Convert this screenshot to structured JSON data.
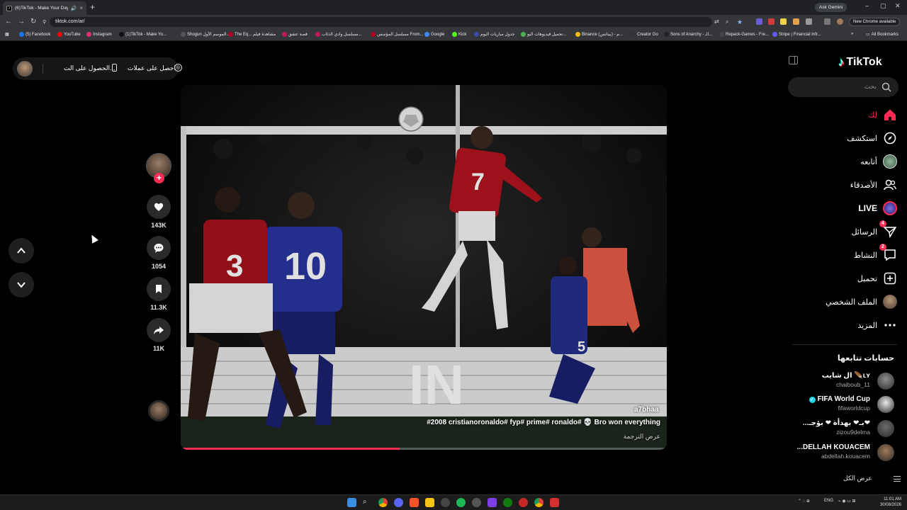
{
  "browser": {
    "tab_title": "(6)TikTok - Make Your Day",
    "url": "tiktok.com/ar/",
    "ask_gemini": "Ask Gemini",
    "new_chrome": "New Chrome available",
    "all_bookmarks": "All Bookmarks",
    "bookmarks": [
      {
        "label": "(5) Facebook",
        "color": "#1877f2"
      },
      {
        "label": "YouTube",
        "color": "#ff0000"
      },
      {
        "label": "Instagram",
        "color": "#e1306c"
      },
      {
        "label": "(1)TikTok - Make Yo...",
        "color": "#111111"
      },
      {
        "label": "Shogun الموسم الأول...",
        "color": "#555555"
      },
      {
        "label": "The Eq... مشاهدة فيلم",
        "color": "#b00020"
      },
      {
        "label": "قصة عشق",
        "color": "#c2185b"
      },
      {
        "label": "مسلسل وادي الذئاب...",
        "color": "#c2185b"
      },
      {
        "label": "مسلسل المؤسس From...",
        "color": "#b00020"
      },
      {
        "label": "Google",
        "color": "#4285f4"
      },
      {
        "label": "Kick",
        "color": "#53fc18"
      },
      {
        "label": "جدول مباريات اليوم",
        "color": "#3949ab"
      },
      {
        "label": "تحميل فيديوهات اليو...",
        "color": "#4caf50"
      },
      {
        "label": "Binance (بينانس) - م...",
        "color": "#f0b90b"
      },
      {
        "label": "Creator Go",
        "color": "#333333"
      },
      {
        "label": "Sons of Anarchy - الـ...",
        "color": "#222222"
      },
      {
        "label": "Repack-Games - Fre...",
        "color": "#444444"
      },
      {
        "label": "Stripe | Financial Infr...",
        "color": "#635bff"
      }
    ]
  },
  "promo": {
    "get_coins": "احصل على عملات",
    "get_app": "الحصول على الت..."
  },
  "actions": {
    "likes": "143K",
    "comments": "1054",
    "saves": "11.3K",
    "shares": "11K"
  },
  "video": {
    "handle": "a7bhaa",
    "caption": "#2008 cristianoronaldo# fyp# prime# ronaldo# 💀 Bro won everything",
    "translate": "عرض الترجمة",
    "progress": 0.45,
    "overlay_text": "IN"
  },
  "sidebar": {
    "logo": "TikTok",
    "search_placeholder": "بحث",
    "nav": {
      "for_you": "لك",
      "explore": "استكشف",
      "following": "أتابعه",
      "friends": "الأصدقاء",
      "live": "LIVE",
      "messages": "الرسائل",
      "messages_badge": "4",
      "activity": "النشاط",
      "activity_badge": "2",
      "upload": "تحميل",
      "profile": "الملف الشخصي",
      "more": "المزيد"
    },
    "following_title": "حسابات تتابعها",
    "accounts": [
      {
        "name": "ال شايب 🪶ʟʏ",
        "handle": "chaiboub_11",
        "verified": false,
        "color": "#8d8d8d"
      },
      {
        "name": "FIFA World Cup",
        "handle": "fifaworldcup",
        "verified": true,
        "color": "#e8e8e8"
      },
      {
        "name": "...بـ❤ بهدأة ❤ بؤجـ❤",
        "handle": "zizou9delma",
        "verified": false,
        "color": "#6b6b6b"
      },
      {
        "name": "...DELLAH KOUACEM",
        "handle": "abdellah.kouacem",
        "verified": false,
        "color": "#a07a5a"
      }
    ],
    "see_all": "عرض الكل"
  },
  "taskbar": {
    "lang": "ENG",
    "time": "11:01 AM",
    "date": "30/08/2026"
  }
}
